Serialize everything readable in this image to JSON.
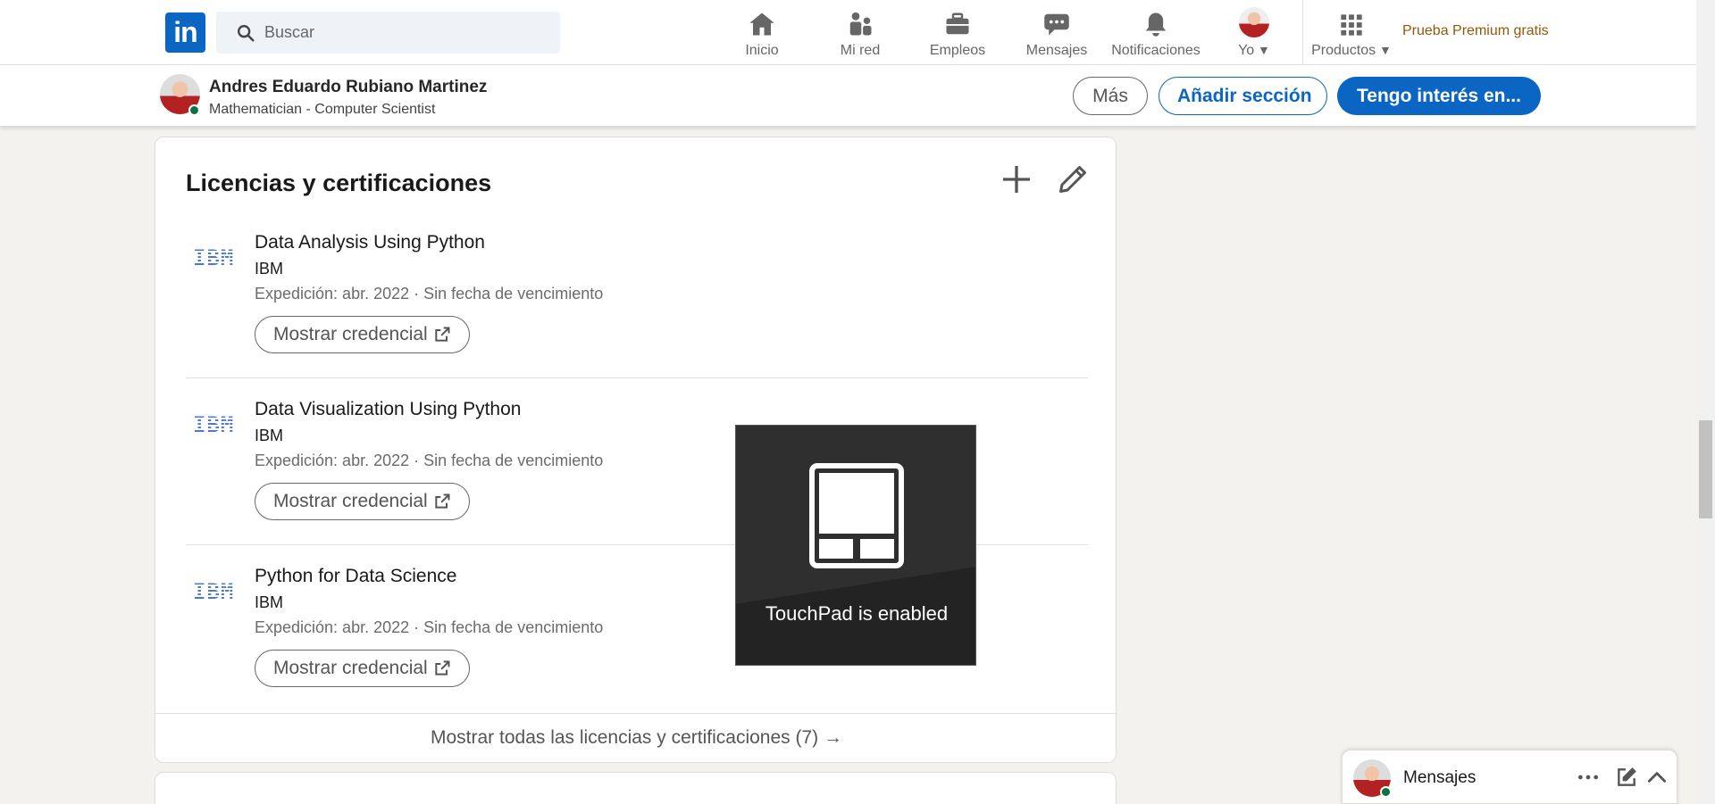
{
  "topnav": {
    "logo": "in",
    "search_placeholder": "Buscar",
    "items": [
      {
        "label": "Inicio",
        "icon": "home-icon"
      },
      {
        "label": "Mi red",
        "icon": "network-icon"
      },
      {
        "label": "Empleos",
        "icon": "briefcase-icon"
      },
      {
        "label": "Mensajes",
        "icon": "messaging-icon"
      },
      {
        "label": "Notificaciones",
        "icon": "bell-icon"
      },
      {
        "label": "Yo",
        "icon": "avatar"
      },
      {
        "label": "Productos",
        "icon": "grid-icon"
      }
    ],
    "premium": "Prueba Premium gratis"
  },
  "profile_header": {
    "name": "Andres Eduardo Rubiano Martinez",
    "headline": "Mathematician - Computer Scientist",
    "more_button": "Más",
    "add_section_button": "Añadir sección",
    "open_to_button": "Tengo interés en..."
  },
  "licenses": {
    "title": "Licencias y certificaciones",
    "items": [
      {
        "logo": "IBM",
        "title": "Data Analysis Using Python",
        "org": "IBM",
        "issued": "Expedición: abr. 2022 · Sin fecha de vencimiento",
        "button": "Mostrar credencial"
      },
      {
        "logo": "IBM",
        "title": "Data Visualization Using Python",
        "org": "IBM",
        "issued": "Expedición: abr. 2022 · Sin fecha de vencimiento",
        "button": "Mostrar credencial"
      },
      {
        "logo": "IBM",
        "title": "Python for Data Science",
        "org": "IBM",
        "issued": "Expedición: abr. 2022 · Sin fecha de vencimiento",
        "button": "Mostrar credencial"
      }
    ],
    "show_all": "Mostrar todas las licencias y certificaciones (7) →"
  },
  "osd": {
    "text": "TouchPad is enabled"
  },
  "messaging": {
    "label": "Mensajes"
  },
  "colors": {
    "brand": "#0a66c2",
    "premium": "#915907",
    "online": "#057642",
    "background": "#f3f2ef"
  }
}
